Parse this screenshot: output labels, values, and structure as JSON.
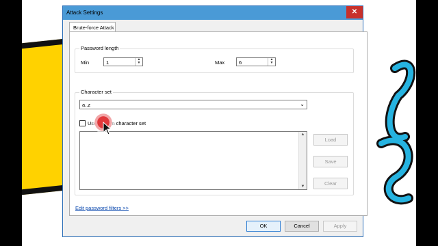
{
  "window": {
    "title": "Attack Settings",
    "close_glyph": "✕"
  },
  "tab": {
    "label": "Brute-force Attack"
  },
  "password_length": {
    "group_title": "Password length",
    "min_label": "Min",
    "min_value": "1",
    "max_label": "Max",
    "max_value": "6"
  },
  "character_set": {
    "group_title": "Character set",
    "selected": "a..z",
    "custom_checkbox_label": "Use custom character set",
    "custom_checked": false,
    "load_label": "Load",
    "save_label": "Save",
    "clear_label": "Clear"
  },
  "link": {
    "label": "Edit password filters >>"
  },
  "buttons": {
    "ok": "OK",
    "cancel": "Cancel",
    "apply": "Apply"
  },
  "colors": {
    "titlebar": "#4a9ad6",
    "close": "#c8312b",
    "accent": "#2b7cd3"
  }
}
